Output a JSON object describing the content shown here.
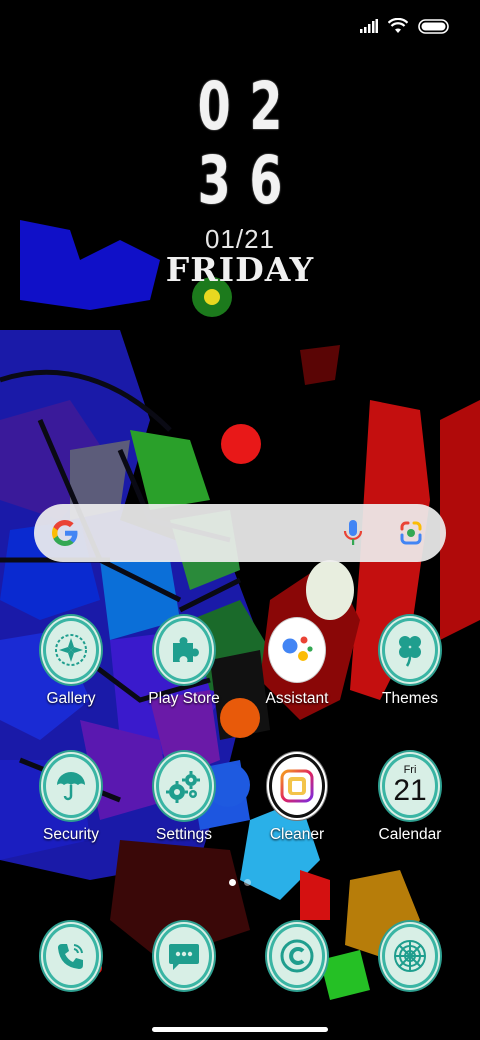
{
  "status_bar": {
    "icons": [
      "signal-icon",
      "wifi-icon",
      "battery-icon"
    ]
  },
  "clock": {
    "hours": "02",
    "minutes": "36",
    "date": "01/21",
    "day": "FRIDAY"
  },
  "search": {
    "icons": [
      "google-icon",
      "mic-icon",
      "lens-icon"
    ]
  },
  "apps": {
    "row1": [
      {
        "label": "Gallery",
        "icon": "gallery-icon"
      },
      {
        "label": "Play Store",
        "icon": "puzzle-icon"
      },
      {
        "label": "Assistant",
        "icon": "assistant-icon"
      },
      {
        "label": "Themes",
        "icon": "clover-icon"
      }
    ],
    "row2": [
      {
        "label": "Security",
        "icon": "umbrella-icon"
      },
      {
        "label": "Settings",
        "icon": "gears-icon"
      },
      {
        "label": "Cleaner",
        "icon": "cleaner-icon"
      },
      {
        "label": "Calendar",
        "icon": "calendar-icon",
        "day": "Fri",
        "date": "21"
      }
    ]
  },
  "dock": [
    {
      "icon": "phone-icon"
    },
    {
      "icon": "messages-icon"
    },
    {
      "icon": "copyright-icon"
    },
    {
      "icon": "browser-icon"
    }
  ],
  "colors": {
    "icon_bg": "#d8efe6",
    "icon_ring": "#3ab5a4",
    "icon_glyph": "#1f9e8e"
  }
}
